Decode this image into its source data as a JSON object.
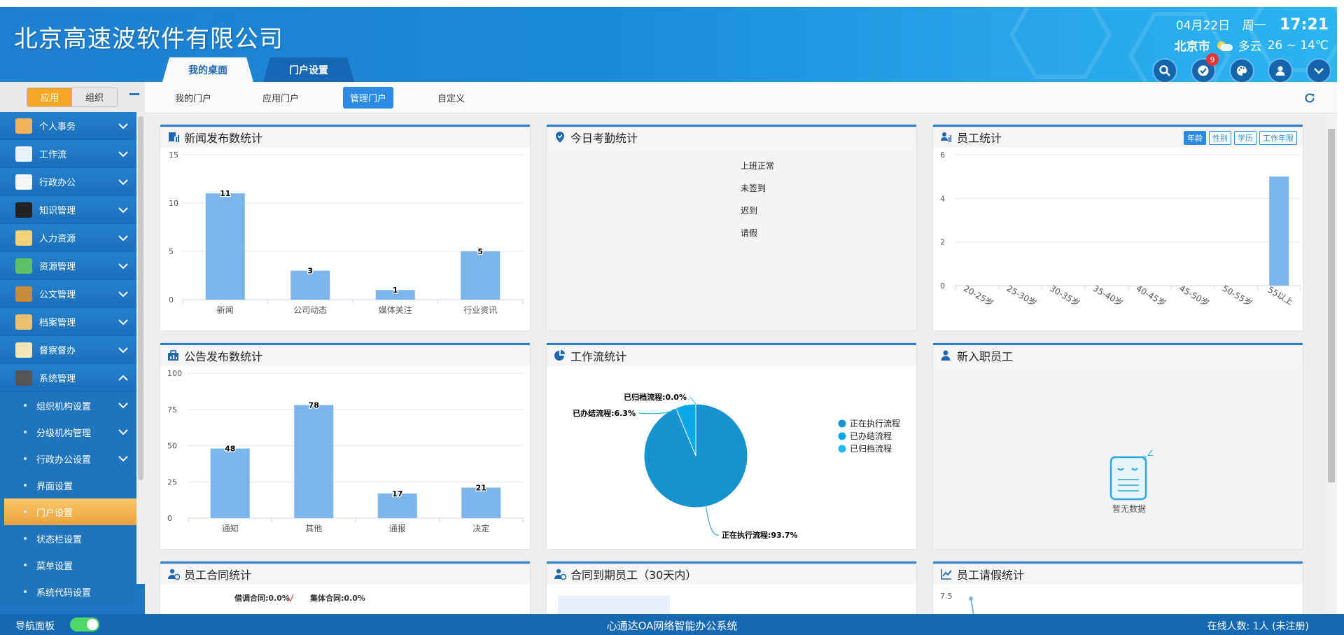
{
  "header": {
    "company": "北京高速波软件有限公司",
    "tabs": [
      "我的桌面",
      "门户设置"
    ],
    "date": "04月22日",
    "weekday": "周一",
    "time": "17:21",
    "city": "北京市",
    "weather": "多云",
    "temp": "26 ~ 14℃",
    "badge_count": "9",
    "icons": [
      "search-icon",
      "check-icon",
      "palette-icon",
      "user-icon",
      "chevron-down-icon"
    ]
  },
  "sidebar": {
    "seg_app": "应用",
    "seg_org": "组织",
    "menu": [
      {
        "label": "个人事务",
        "icon": "person-icon"
      },
      {
        "label": "工作流",
        "icon": "workflow-icon"
      },
      {
        "label": "行政办公",
        "icon": "printer-icon"
      },
      {
        "label": "知识管理",
        "icon": "book-icon"
      },
      {
        "label": "人力资源",
        "icon": "hr-icon"
      },
      {
        "label": "资源管理",
        "icon": "layers-icon"
      },
      {
        "label": "公文管理",
        "icon": "briefcase-icon"
      },
      {
        "label": "档案管理",
        "icon": "archive-icon"
      },
      {
        "label": "督察督办",
        "icon": "clipboard-icon"
      },
      {
        "label": "系统管理",
        "icon": "monitor-icon"
      }
    ],
    "submenu": [
      {
        "label": "组织机构设置",
        "expand": true
      },
      {
        "label": "分级机构管理",
        "expand": true
      },
      {
        "label": "行政办公设置",
        "expand": true
      },
      {
        "label": "界面设置",
        "expand": false
      },
      {
        "label": "门户设置",
        "expand": false,
        "active": true
      },
      {
        "label": "状态栏设置",
        "expand": false
      },
      {
        "label": "菜单设置",
        "expand": false
      },
      {
        "label": "系统代码设置",
        "expand": false
      }
    ]
  },
  "subnav": [
    "我的门户",
    "应用门户",
    "管理门户",
    "自定义"
  ],
  "cards": {
    "news": "新闻发布数统计",
    "attendance": "今日考勤统计",
    "staff": "员工统计",
    "notice": "公告发布数统计",
    "workflow": "工作流统计",
    "newstaff": "新入职员工",
    "contract": "员工合同统计",
    "expire": "合同到期员工（30天内）",
    "leave": "员工请假统计"
  },
  "attendance_legend": [
    "上班正常",
    "未签到",
    "迟到",
    "请假"
  ],
  "staff_tabs": [
    "年龄",
    "性别",
    "学历",
    "工作年限"
  ],
  "newstaff_empty": "暂无数据",
  "contract_labels": [
    "借调合同:0.0%",
    "集体合同:0.0%"
  ],
  "leave_axis_top": "7.5",
  "chart_data": [
    {
      "type": "bar",
      "title": "新闻发布数统计",
      "categories": [
        "新闻",
        "公司动态",
        "媒体关注",
        "行业资讯"
      ],
      "values": [
        11,
        3,
        1,
        5
      ],
      "ylim": [
        0,
        15
      ],
      "yticks": [
        0,
        5,
        10,
        15
      ],
      "color": "#7cb5ec"
    },
    {
      "type": "bar",
      "title": "员工统计",
      "categories": [
        "20-25岁",
        "25-30岁",
        "30-35岁",
        "35-40岁",
        "40-45岁",
        "45-50岁",
        "50-55岁",
        "55以上"
      ],
      "values": [
        0,
        0,
        0,
        0,
        0,
        0,
        0,
        5
      ],
      "ylim": [
        0,
        6
      ],
      "yticks": [
        0,
        2,
        4,
        6
      ],
      "color": "#7cb5ec"
    },
    {
      "type": "bar",
      "title": "公告发布数统计",
      "categories": [
        "通知",
        "其他",
        "通报",
        "决定"
      ],
      "values": [
        48,
        78,
        17,
        21
      ],
      "ylim": [
        0,
        100
      ],
      "yticks": [
        0,
        25,
        50,
        75,
        100
      ],
      "color": "#7cb5ec"
    },
    {
      "type": "pie",
      "title": "工作流统计",
      "slices": [
        {
          "name": "正在执行流程",
          "value": 93.7,
          "label": "正在执行流程:93.7%",
          "color": "#1693cf"
        },
        {
          "name": "已办结流程",
          "value": 6.3,
          "label": "已办结流程:6.3%",
          "color": "#0aa6e6"
        },
        {
          "name": "已归档流程",
          "value": 0.0,
          "label": "已归档流程:0.0%",
          "color": "#20b8ef"
        }
      ]
    }
  ],
  "footer": {
    "nav_panel": "导航面板",
    "system": "心通达OA网络智能办公系统",
    "online": "在线人数:  1人  (未注册)"
  }
}
